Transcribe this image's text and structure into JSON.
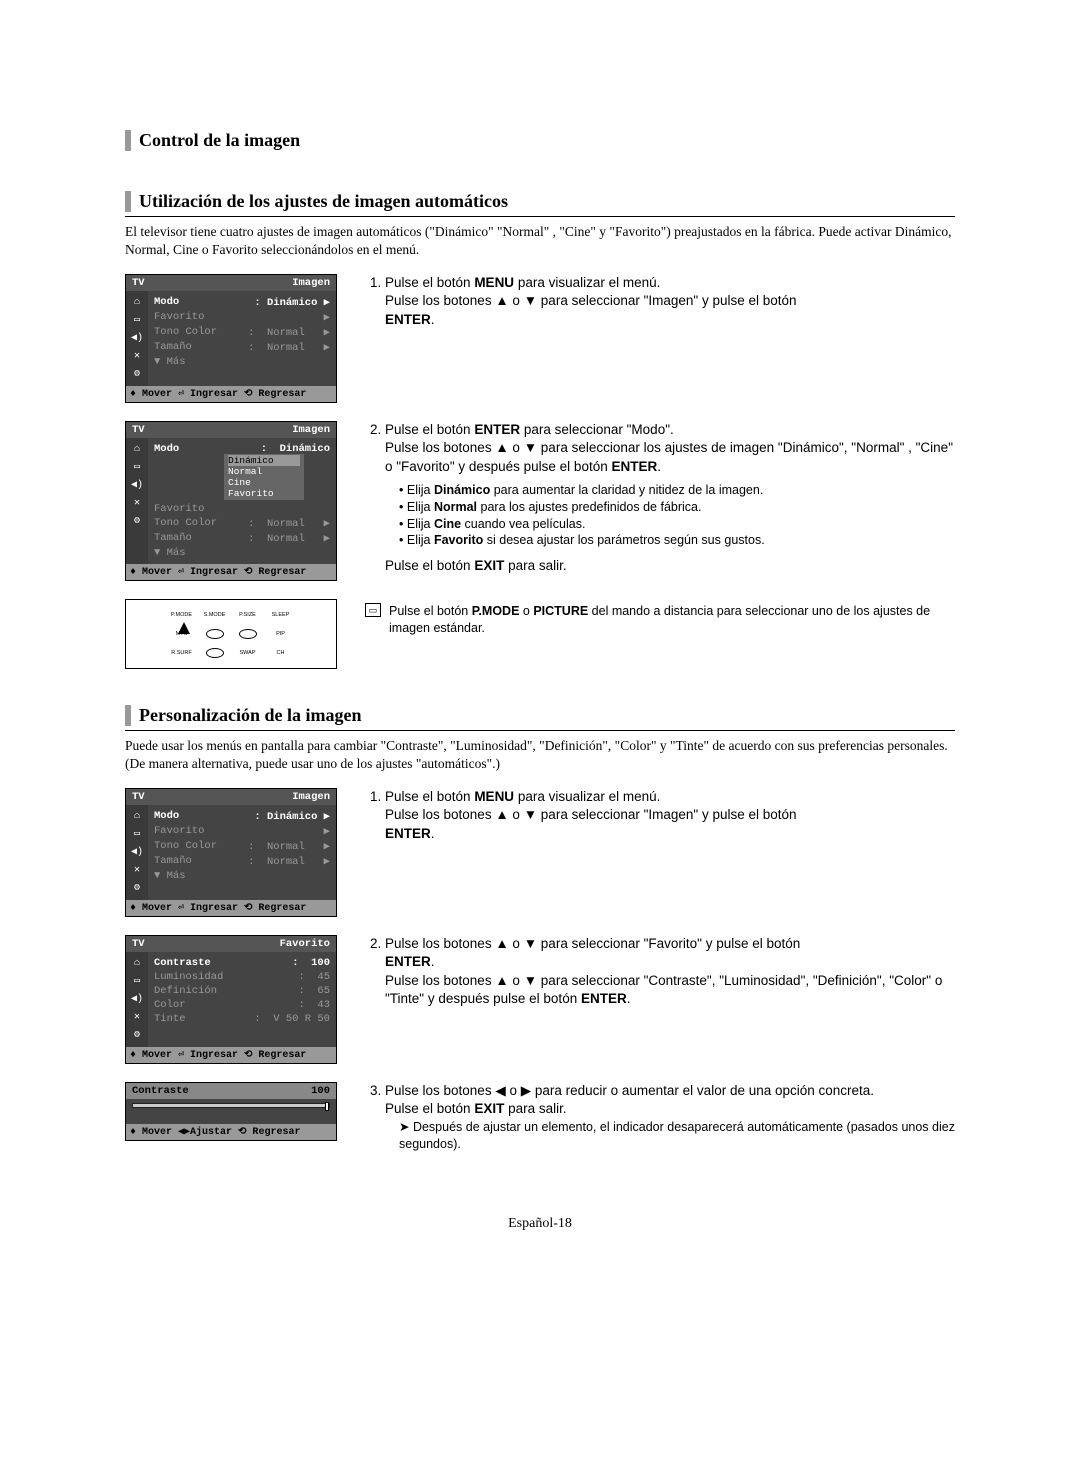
{
  "section1_title": "Control de la imagen",
  "section2_heading": "Utilización de los ajustes de imagen automáticos",
  "intro1": "El televisor tiene cuatro ajustes de imagen automáticos (\"Dinámico\" \"Normal\" , \"Cine\" y \"Favorito\") preajustados en la fábrica. Puede activar Dinámico, Normal, Cine o Favorito seleccionándolos en el menú.",
  "tvmenu1": {
    "tv": "TV",
    "title": "Imagen",
    "rows": [
      {
        "label": "Modo",
        "val": ": Dinámico ▶",
        "hl": true
      },
      {
        "label": "Favorito",
        "val": "▶"
      },
      {
        "label": "Tono Color",
        "val": ":  Normal   ▶"
      },
      {
        "label": "Tamaño",
        "val": ":  Normal   ▶"
      },
      {
        "label": "▼ Más",
        "val": ""
      }
    ],
    "footer": "♦ Mover  ⏎ Ingresar ⟲ Regresar"
  },
  "tvmenu2": {
    "tv": "TV",
    "title": "Imagen",
    "rows": [
      {
        "label": "Modo",
        "val": ":  Dinámico",
        "hl": true
      }
    ],
    "options": [
      "Normal",
      "Cine",
      "Favorito"
    ],
    "opt_sel": "Dinámico",
    "rows2": [
      {
        "label": "Favorito",
        "val": ""
      },
      {
        "label": "Tono Color",
        "val": ":  Normal   ▶"
      },
      {
        "label": "Tamaño",
        "val": ":  Normal   ▶"
      },
      {
        "label": "▼ Más",
        "val": ""
      }
    ],
    "footer": "♦ Mover  ⏎ Ingresar ⟲ Regresar"
  },
  "remote_labels": [
    "P.MODE",
    "S.MODE",
    "P.SIZE",
    "SLEEP",
    "MTS",
    "",
    "",
    "PIP",
    "R.SURF",
    "",
    "SWAP",
    "CH"
  ],
  "step1_1a": "Pulse el botón ",
  "step1_1b": "MENU",
  "step1_1c": " para visualizar el menú.",
  "step1_2": "Pulse los botones ▲ o ▼ para seleccionar \"Imagen\" y pulse el botón ",
  "enter": "ENTER",
  "step2_1a": "Pulse el botón ",
  "step2_1b": "ENTER",
  "step2_1c": " para seleccionar \"Modo\".",
  "step2_2": "Pulse los botones ▲ o ▼ para seleccionar los ajustes de imagen \"Dinámico\", \"Normal\" , \"Cine\" o \"Favorito\" y después pulse el botón ",
  "bullets": [
    "Elija Dinámico para aumentar la claridad y nitidez de la imagen.",
    "Elija Normal para los ajustes predefinidos de fábrica.",
    "Elija Cine cuando vea películas.",
    "Elija Favorito si desea ajustar los parámetros según sus gustos."
  ],
  "bullets_bold": [
    "Dinámico",
    "Normal",
    "Cine",
    "Favorito"
  ],
  "exit_line_a": "Pulse el botón ",
  "exit_line_b": "EXIT",
  "exit_line_c": " para salir.",
  "pmode_note_a": "Pulse el botón ",
  "pmode_note_b": "P.MODE",
  "pmode_note_c": " o ",
  "pmode_note_d": "PICTURE",
  "pmode_note_e": " del mando a distancia para seleccionar uno de los ajustes de imagen estándar.",
  "section3_heading": "Personalización de la imagen",
  "intro2": "Puede usar los menús en pantalla para cambiar \"Contraste\", \"Luminosidad\", \"Definición\", \"Color\" y \"Tinte\" de acuerdo con sus preferencias personales. (De manera alternativa, puede usar uno de los ajustes \"automáticos\".)",
  "tvmenu3": {
    "tv": "TV",
    "title": "Imagen",
    "rows": [
      {
        "label": "Modo",
        "val": ": Dinámico ▶",
        "hl": true
      },
      {
        "label": "Favorito",
        "val": "▶"
      },
      {
        "label": "Tono Color",
        "val": ":  Normal   ▶"
      },
      {
        "label": "Tamaño",
        "val": ":  Normal   ▶"
      },
      {
        "label": "▼ Más",
        "val": ""
      }
    ],
    "footer": "♦ Mover  ⏎ Ingresar ⟲ Regresar"
  },
  "tvmenu4": {
    "tv": "TV",
    "title": "Favorito",
    "rows": [
      {
        "label": "Contraste",
        "val": ":  100",
        "hl": true
      },
      {
        "label": "Luminosidad",
        "val": ":  45"
      },
      {
        "label": "Definición",
        "val": ":  65"
      },
      {
        "label": "Color",
        "val": ":  43"
      },
      {
        "label": "Tinte",
        "val": ":  V 50 R 50"
      }
    ],
    "footer": "♦ Mover  ⏎ Ingresar ⟲ Regresar"
  },
  "slider": {
    "label": "Contraste",
    "val": "100",
    "footer": "♦ Mover  ◀▶Ajustar  ⟲ Regresar"
  },
  "p3_step1_a": "Pulse el botón ",
  "p3_step1_b": "MENU",
  "p3_step1_c": " para visualizar el menú.",
  "p3_step1_2": "Pulse los botones ▲ o ▼ para seleccionar \"Imagen\" y pulse el botón ",
  "p3_step2_1": "Pulse los botones ▲ o ▼ para seleccionar \"Favorito\" y pulse el botón ",
  "p3_step2_2": "Pulse los botones ▲ o ▼ para seleccionar \"Contraste\", \"Luminosidad\", \"Definición\", \"Color\" o \"Tinte\" y después pulse el botón ",
  "p3_step3_1": "Pulse los botones ◀ o ▶ para reducir o aumentar el valor de una opción concreta.",
  "p3_step3_2a": "Pulse el botón ",
  "p3_step3_2b": "EXIT",
  "p3_step3_2c": " para salir.",
  "p3_arrow": "Después de ajustar un elemento, el indicador desaparecerá automáticamente (pasados unos diez segundos).",
  "page_footer": "Español-18"
}
